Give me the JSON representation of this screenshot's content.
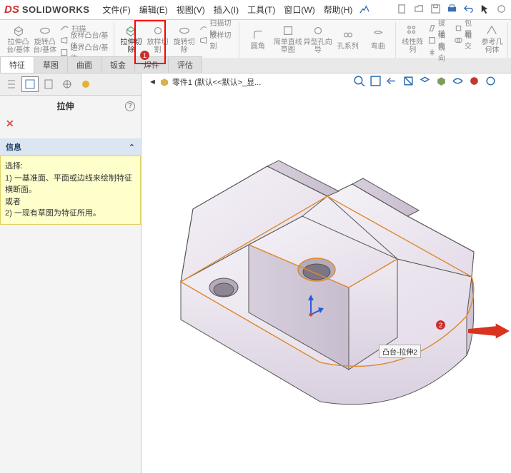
{
  "logo": {
    "ds": "DS",
    "sw": "SOLIDWORKS"
  },
  "menu": [
    "文件(F)",
    "编辑(E)",
    "视图(V)",
    "插入(I)",
    "工具(T)",
    "窗口(W)",
    "帮助(H)"
  ],
  "ribbon": {
    "extrude": "拉伸凸台/基体",
    "revolve": "旋转凸台/基体",
    "sweep": "扫描",
    "loft": "放样凸台/基体",
    "boundary": "边界凸台/基体",
    "cut_extrude": "拉伸切除",
    "wizard": "放样切割",
    "revcut": "旋转切除",
    "sweepcut": "扫描切除",
    "loftcut": "放样切割",
    "fillet": "圆角",
    "simpledraft": "简单直线草图",
    "holewiz": "异型孔向导",
    "holeseries": "孔系列",
    "wrap": "弯曲",
    "linpattern": "线性阵列",
    "draft": "拔模",
    "intersect": "相交",
    "refgeo": "参考几何体",
    "shell": "抽壳",
    "mirror": "镜向",
    "wrapbtn": "包覆"
  },
  "tabs": [
    "特征",
    "草图",
    "曲面",
    "钣金",
    "焊件",
    "评估"
  ],
  "panel": {
    "title": "拉伸",
    "section": "信息",
    "info": {
      "sel": "选择:",
      "l1": "1) 一基准面、平面或边线来绘制特征横断面。",
      "or": "或者",
      "l2": "2) 一现有草图为特征所用。"
    }
  },
  "breadcrumb": {
    "part": "零件1 (默认<<默认>_显..."
  },
  "tag": "凸台-拉伸2",
  "annotations": {
    "n1": "1",
    "n2": "2"
  }
}
